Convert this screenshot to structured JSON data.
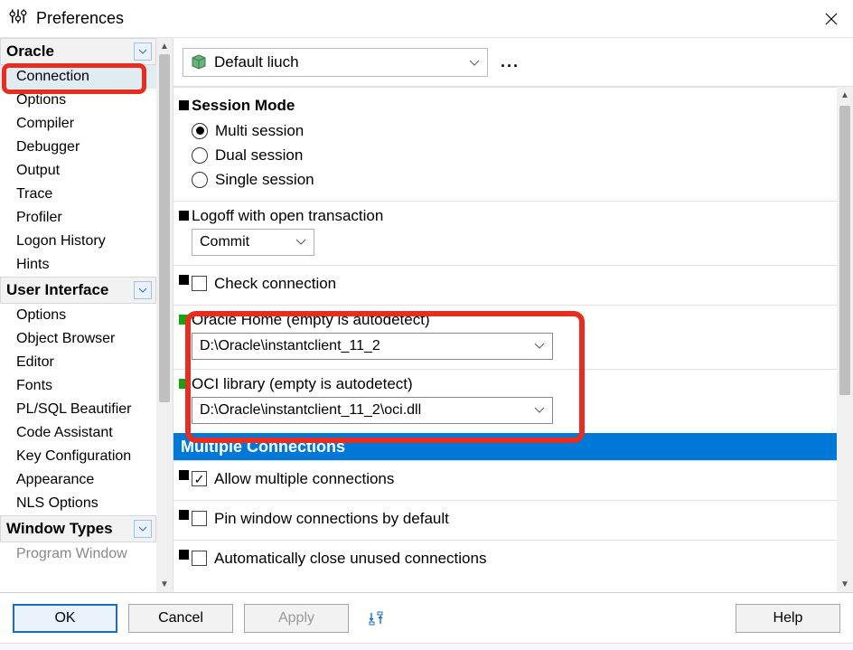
{
  "window": {
    "title": "Preferences"
  },
  "sidebar": {
    "categories": [
      {
        "name": "Oracle",
        "items": [
          "Connection",
          "Options",
          "Compiler",
          "Debugger",
          "Output",
          "Trace",
          "Profiler",
          "Logon History",
          "Hints"
        ],
        "selected_index": 0
      },
      {
        "name": "User Interface",
        "items": [
          "Options",
          "Object Browser",
          "Editor",
          "Fonts",
          "PL/SQL Beautifier",
          "Code Assistant",
          "Key Configuration",
          "Appearance",
          "NLS Options"
        ]
      },
      {
        "name": "Window Types",
        "items": [
          "Program Window"
        ]
      }
    ]
  },
  "toolbar": {
    "profile_selected": "Default liuch",
    "more_label": "..."
  },
  "form": {
    "session_mode": {
      "heading": "Session Mode",
      "options": [
        "Multi session",
        "Dual session",
        "Single session"
      ],
      "selected": "Multi session"
    },
    "logoff": {
      "label": "Logoff with open transaction",
      "value": "Commit"
    },
    "check_connection": {
      "label": "Check connection",
      "checked": false
    },
    "oracle_home": {
      "label": "Oracle Home (empty is autodetect)",
      "value": "D:\\Oracle\\instantclient_11_2"
    },
    "oci_library": {
      "label": "OCI library (empty is autodetect)",
      "value": "D:\\Oracle\\instantclient_11_2\\oci.dll"
    },
    "multiple_connections": {
      "header": "Multiple Connections",
      "allow": {
        "label": "Allow multiple connections",
        "checked": true
      },
      "pin": {
        "label": "Pin window connections by default",
        "checked": false
      },
      "auto": {
        "label": "Automatically close unused connections",
        "checked": false
      }
    }
  },
  "buttons": {
    "ok": "OK",
    "cancel": "Cancel",
    "apply": "Apply",
    "help": "Help"
  }
}
